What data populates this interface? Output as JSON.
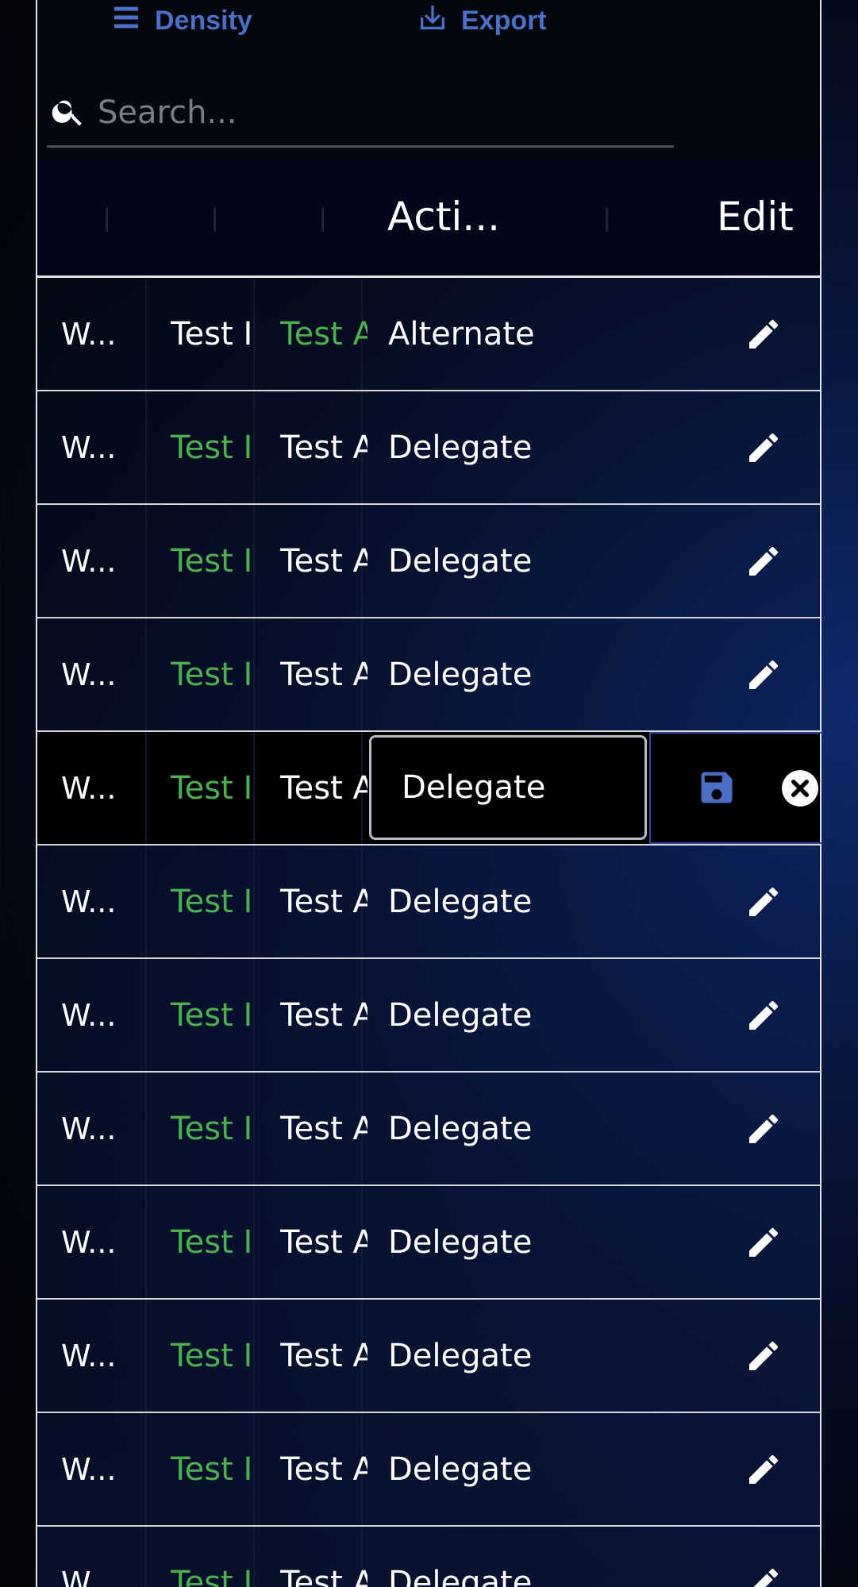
{
  "toolbar": {
    "density_label": "Density",
    "export_label": "Export",
    "search_placeholder": "Search..."
  },
  "table": {
    "columns": [
      "",
      "",
      "",
      "Acti...",
      "",
      "Edit"
    ],
    "rows": [
      {
        "c1": "W...",
        "c2": "Test I",
        "c3": "Test A",
        "c4": "Alternate",
        "c2_green": false,
        "c3_green": true
      },
      {
        "c1": "W...",
        "c2": "Test I",
        "c3": "Test A",
        "c4": "Delegate",
        "c2_green": true,
        "c3_green": false
      },
      {
        "c1": "W...",
        "c2": "Test I",
        "c3": "Test A",
        "c4": "Delegate",
        "c2_green": true,
        "c3_green": false
      },
      {
        "c1": "W...",
        "c2": "Test I",
        "c3": "Test A",
        "c4": "Delegate",
        "c2_green": true,
        "c3_green": false
      },
      {
        "c1": "W...",
        "c2": "Test I",
        "c3": "Test A",
        "c4": "Delegate",
        "c2_green": true,
        "c3_green": false,
        "editing": true
      },
      {
        "c1": "W...",
        "c2": "Test I",
        "c3": "Test A",
        "c4": "Delegate",
        "c2_green": true,
        "c3_green": false
      },
      {
        "c1": "W...",
        "c2": "Test I",
        "c3": "Test A",
        "c4": "Delegate",
        "c2_green": true,
        "c3_green": false
      },
      {
        "c1": "W...",
        "c2": "Test I",
        "c3": "Test A",
        "c4": "Delegate",
        "c2_green": true,
        "c3_green": false
      },
      {
        "c1": "W...",
        "c2": "Test I",
        "c3": "Test A",
        "c4": "Delegate",
        "c2_green": true,
        "c3_green": false
      },
      {
        "c1": "W...",
        "c2": "Test I",
        "c3": "Test A",
        "c4": "Delegate",
        "c2_green": true,
        "c3_green": false
      },
      {
        "c1": "W...",
        "c2": "Test I",
        "c3": "Test A",
        "c4": "Delegate",
        "c2_green": true,
        "c3_green": false
      },
      {
        "c1": "W...",
        "c2": "Test I",
        "c3": "Test A",
        "c4": "Delegate",
        "c2_green": true,
        "c3_green": false
      }
    ]
  },
  "icons": {
    "density": "density-icon",
    "export": "export-icon",
    "search": "search-icon",
    "edit": "pencil-icon",
    "save": "save-icon",
    "cancel": "cancel-icon"
  },
  "colors": {
    "accent": "#4a6fc4",
    "green_text": "#4caf50",
    "row_border": "#d8d8d8"
  }
}
